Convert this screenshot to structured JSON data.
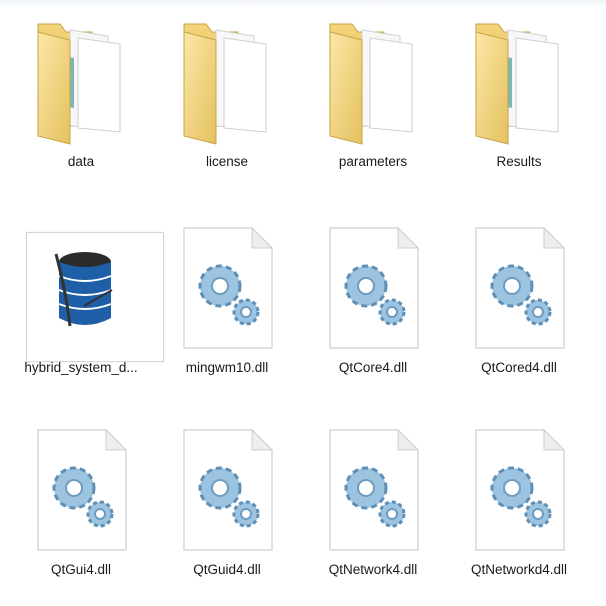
{
  "items": [
    {
      "label": "data",
      "type": "folder",
      "icon": "folder-icon"
    },
    {
      "label": "license",
      "type": "folder",
      "icon": "folder-icon"
    },
    {
      "label": "parameters",
      "type": "folder",
      "icon": "folder-icon"
    },
    {
      "label": "Results",
      "type": "folder",
      "icon": "folder-icon"
    },
    {
      "label": "hybrid_system_d...",
      "type": "application",
      "icon": "database-app-icon"
    },
    {
      "label": "mingwm10.dll",
      "type": "dll",
      "icon": "dll-gears-icon"
    },
    {
      "label": "QtCore4.dll",
      "type": "dll",
      "icon": "dll-gears-icon"
    },
    {
      "label": "QtCored4.dll",
      "type": "dll",
      "icon": "dll-gears-icon"
    },
    {
      "label": "QtGui4.dll",
      "type": "dll",
      "icon": "dll-gears-icon"
    },
    {
      "label": "QtGuid4.dll",
      "type": "dll",
      "icon": "dll-gears-icon"
    },
    {
      "label": "QtNetwork4.dll",
      "type": "dll",
      "icon": "dll-gears-icon"
    },
    {
      "label": "QtNetworkd4.dll",
      "type": "dll",
      "icon": "dll-gears-icon"
    }
  ],
  "colors": {
    "folder_back": "#e8c766",
    "folder_front": "#f6dc8a",
    "paper": "#ffffff",
    "gear": "#8fb9d9",
    "db_blue": "#1f5fa8"
  }
}
